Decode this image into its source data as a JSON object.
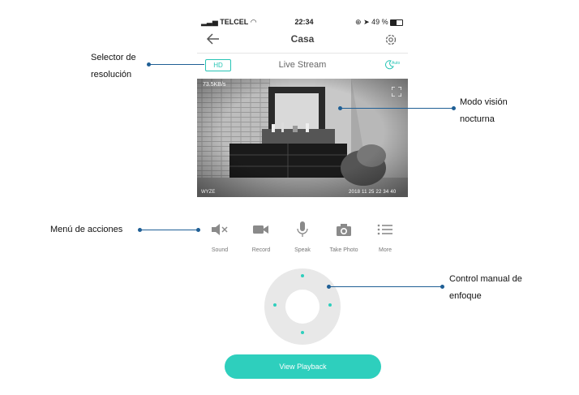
{
  "status_bar": {
    "carrier": "TELCEL",
    "time": "22:34",
    "battery": "49 %"
  },
  "header": {
    "title": "Casa",
    "back_icon": "arrow-left-icon",
    "settings_icon": "gear-icon"
  },
  "stream_bar": {
    "resolution_label": "HD",
    "title": "Live Stream",
    "mode_label": "Auto"
  },
  "video": {
    "bitrate": "73.5KB/s",
    "timestamp": "2018 11 25 22 34 40",
    "watermark": "WYZE",
    "fullscreen_icon": "fullscreen-icon"
  },
  "actions": [
    {
      "label": "Sound",
      "icon": "speaker-mute-icon"
    },
    {
      "label": "Record",
      "icon": "video-camera-icon"
    },
    {
      "label": "Speak",
      "icon": "microphone-icon"
    },
    {
      "label": "Take Photo",
      "icon": "camera-icon"
    },
    {
      "label": "More",
      "icon": "list-icon"
    }
  ],
  "playback_button": "View Playback",
  "annotations": {
    "resolution_selector": [
      "Selector de",
      "resolución"
    ],
    "night_vision": [
      "Modo visión",
      "nocturna"
    ],
    "actions_menu": "Menú de acciones",
    "focus_control": [
      "Control manual de",
      "enfoque"
    ]
  },
  "colors": {
    "accent": "#2ecfbd",
    "annotation": "#1f5f95"
  }
}
